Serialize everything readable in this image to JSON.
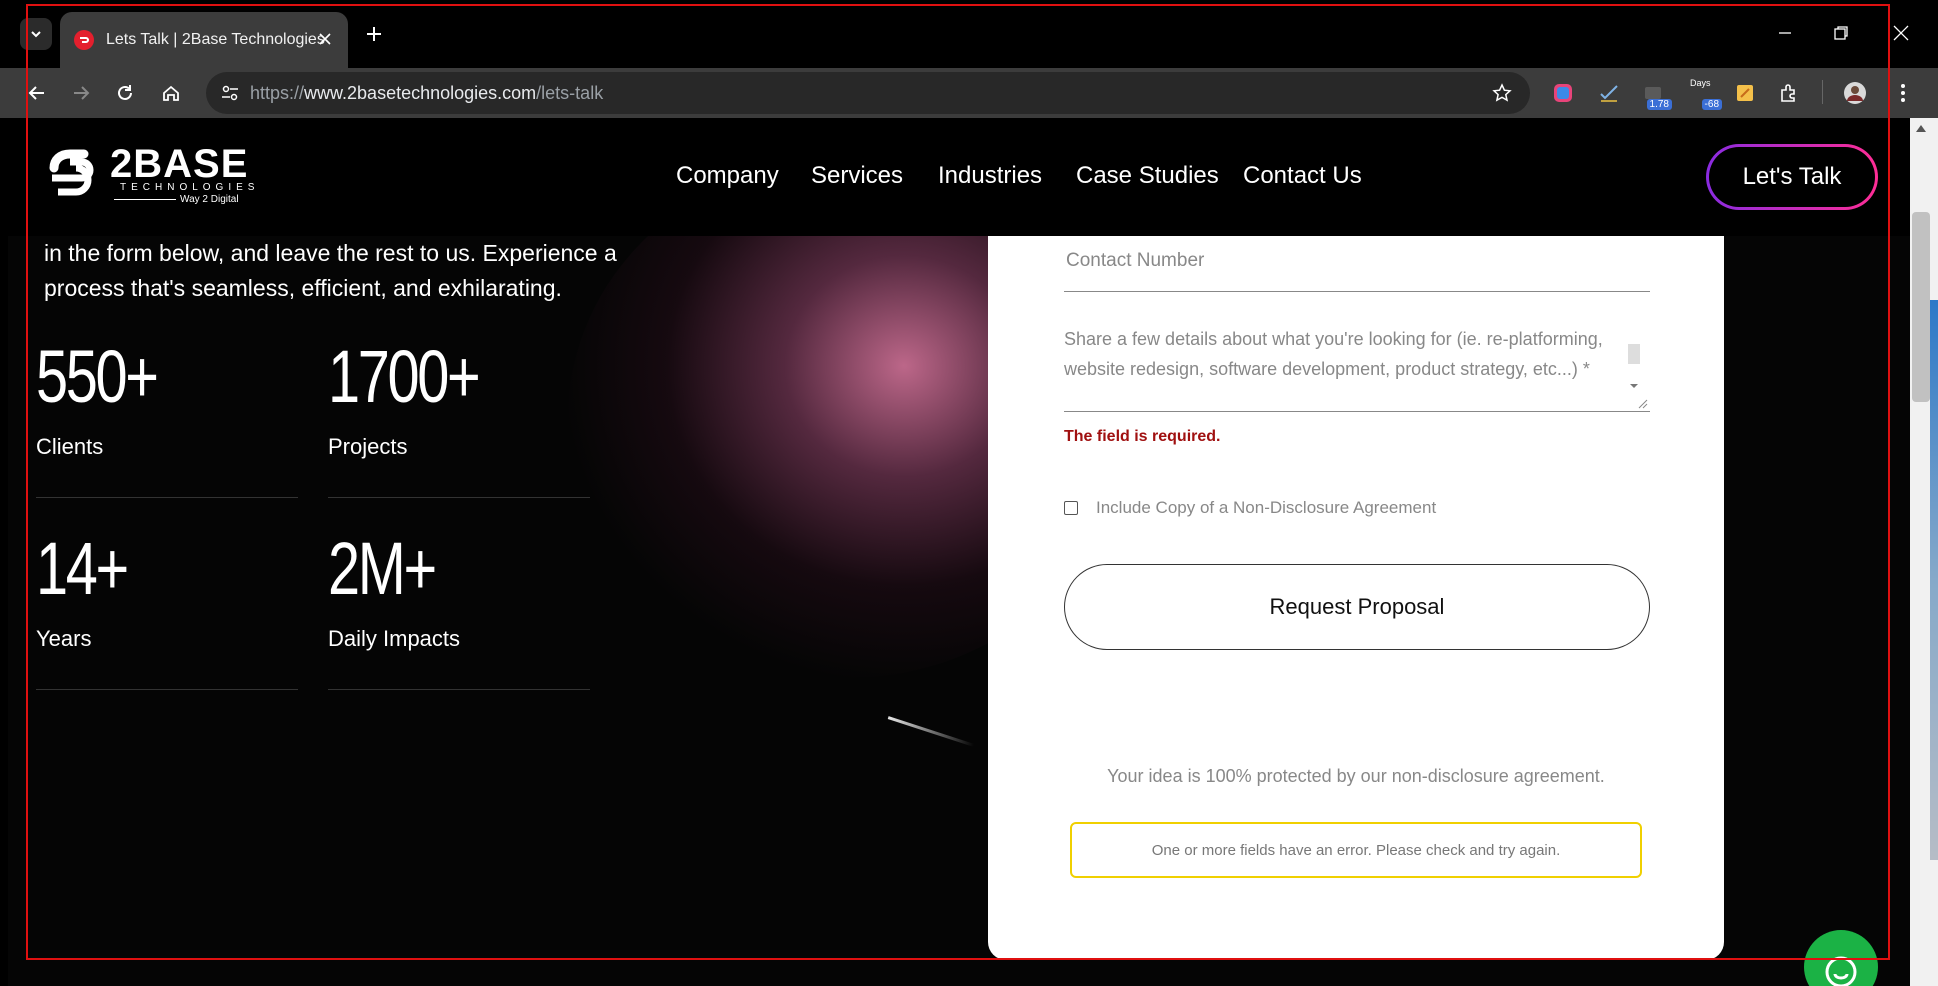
{
  "browser": {
    "tab_title": "Lets Talk | 2Base Technologies",
    "url_scheme": "https://",
    "url_host": "www.2basetechnologies.com",
    "url_path": "/lets-talk",
    "extensions": [
      {
        "icon": "color-picker-icon"
      },
      {
        "icon": "spell-check-icon"
      },
      {
        "icon": "rating-extension-icon",
        "badge": "1.78"
      },
      {
        "icon": "days-counter-icon",
        "label": "Days",
        "badge": "-68"
      },
      {
        "icon": "notes-extension-icon"
      },
      {
        "icon": "extensions-puzzle-icon"
      }
    ]
  },
  "header": {
    "logo_name": "2BASE",
    "logo_sub": "TECHNOLOGIES",
    "logo_tagline": "Way 2 Digital",
    "nav": [
      "Company",
      "Services",
      "Industries",
      "Case Studies",
      "Contact Us"
    ],
    "cta": "Let's Talk"
  },
  "intro": {
    "text": "in the form below, and leave the rest to us. Experience a process that's seamless, efficient, and exhilarating."
  },
  "stats": [
    {
      "value": "550+",
      "label": "Clients"
    },
    {
      "value": "1700+",
      "label": "Projects"
    },
    {
      "value": "14+",
      "label": "Years"
    },
    {
      "value": "2M+",
      "label": "Daily Impacts"
    }
  ],
  "form": {
    "contact_placeholder": "Contact Number",
    "details_placeholder": "Share a few details about what you're looking for (ie. re-platforming, website redesign, software development, product strategy, etc...) *",
    "details_error": "The field is required.",
    "nda_label": "Include Copy of a Non-Disclosure Agreement",
    "nda_checked": false,
    "submit_label": "Request Proposal",
    "protection_note": "Your idea is 100% protected by our non-disclosure agreement.",
    "form_error": "One or more fields have an error. Please check and try again."
  },
  "colors": {
    "accent_gradient_start": "#8a2be2",
    "accent_gradient_end": "#ff2d95",
    "error": "#a01010",
    "alert_border": "#f0d000",
    "chat_button": "#1bb245",
    "favicon": "#e41f2d"
  }
}
